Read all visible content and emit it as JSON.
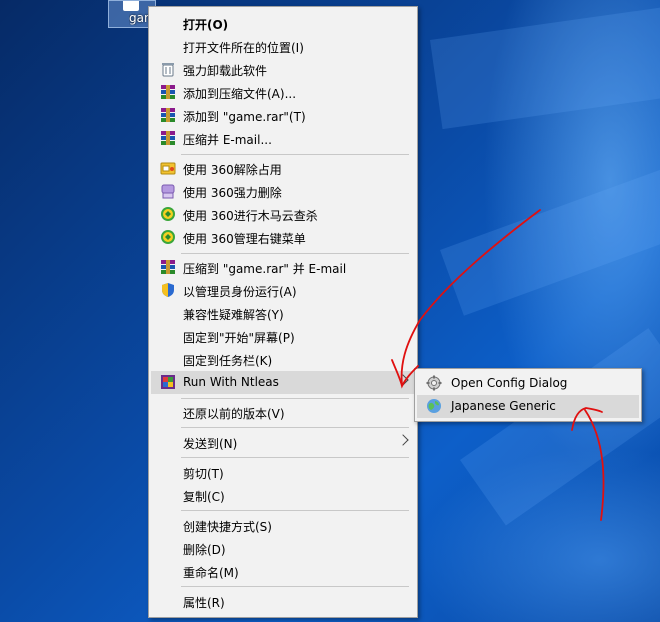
{
  "desktop": {
    "icon_label": "game"
  },
  "menu": {
    "items": [
      {
        "label": "打开(O)",
        "bold": true,
        "icon": "none"
      },
      {
        "label": "打开文件所在的位置(I)",
        "icon": "none"
      },
      {
        "label": "强力卸载此软件",
        "icon": "trash-icon"
      },
      {
        "label": "添加到压缩文件(A)...",
        "icon": "winrar-icon"
      },
      {
        "label": "添加到 \"game.rar\"(T)",
        "icon": "winrar-icon"
      },
      {
        "label": "压缩并 E-mail...",
        "icon": "winrar-icon"
      },
      {
        "label": "使用 360解除占用",
        "icon": "360-unlock-icon"
      },
      {
        "label": "使用 360强力删除",
        "icon": "360-shred-icon"
      },
      {
        "label": "使用 360进行木马云查杀",
        "icon": "360-scan-icon"
      },
      {
        "label": "使用 360管理右键菜单",
        "icon": "360-scan-icon"
      },
      {
        "label": "压缩到 \"game.rar\" 并 E-mail",
        "icon": "winrar-icon"
      },
      {
        "label": "以管理员身份运行(A)",
        "icon": "uac-shield-icon"
      },
      {
        "label": "兼容性疑难解答(Y)",
        "icon": "none"
      },
      {
        "label": "固定到\"开始\"屏幕(P)",
        "icon": "none"
      },
      {
        "label": "固定到任务栏(K)",
        "icon": "none"
      },
      {
        "label": "Run With Ntleas",
        "icon": "ntleas-icon",
        "submenu": true
      },
      {
        "label": "还原以前的版本(V)",
        "icon": "none"
      },
      {
        "label": "发送到(N)",
        "icon": "none",
        "submenu": true
      },
      {
        "label": "剪切(T)",
        "icon": "none"
      },
      {
        "label": "复制(C)",
        "icon": "none"
      },
      {
        "label": "创建快捷方式(S)",
        "icon": "none"
      },
      {
        "label": "删除(D)",
        "icon": "none"
      },
      {
        "label": "重命名(M)",
        "icon": "none"
      },
      {
        "label": "属性(R)",
        "icon": "none"
      }
    ]
  },
  "submenu": {
    "items": [
      {
        "label": "Open Config Dialog",
        "icon": "gear-icon"
      },
      {
        "label": "Japanese Generic",
        "icon": "globe-icon"
      }
    ]
  },
  "colors": {
    "menu_bg": "#f2f2f2",
    "highlight": "#d9d9d9",
    "annotation": "#e01010"
  }
}
